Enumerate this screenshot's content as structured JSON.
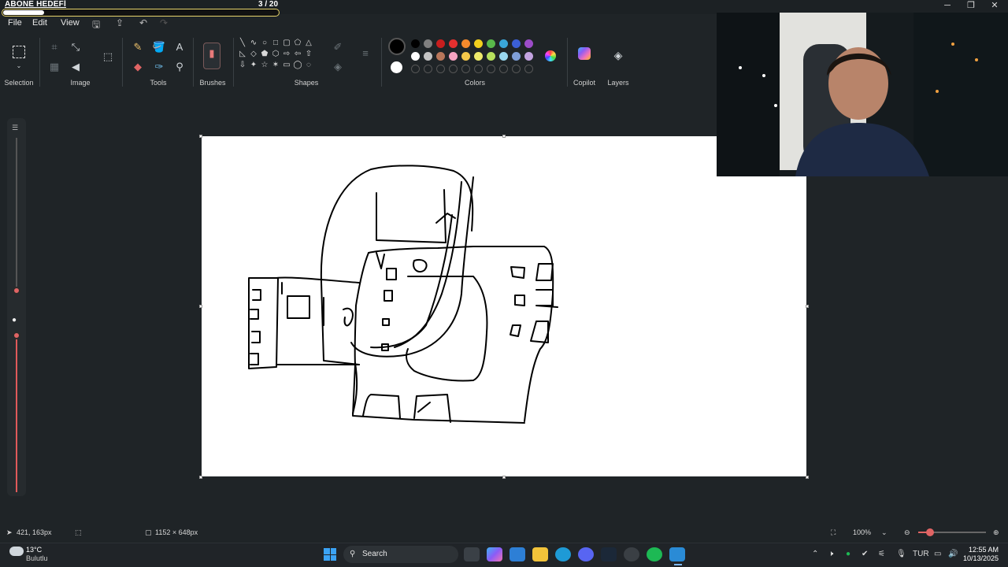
{
  "overlay": {
    "goal_label": "ABONE HEDEFİ",
    "goal_count": "3 / 20",
    "goal_progress": 0.15
  },
  "window": {
    "min": "─",
    "max": "❐",
    "close": "✕"
  },
  "menu": {
    "file": "File",
    "edit": "Edit",
    "view": "View"
  },
  "ribbon": {
    "groups": {
      "selection": "Selection",
      "image": "Image",
      "tools": "Tools",
      "brushes": "Brushes",
      "shapes": "Shapes",
      "colors": "Colors",
      "copilot": "Copilot",
      "layers": "Layers"
    },
    "palette_row1": [
      "#000000",
      "#7f7f7f",
      "#c81e1e",
      "#e5302f",
      "#f58a2c",
      "#f2cf1d",
      "#59b84a",
      "#3aa6d8",
      "#3b5fd6",
      "#9c4cc8"
    ],
    "palette_row2": [
      "#ffffff",
      "#c3c3c3",
      "#b8765a",
      "#f5a3c0",
      "#f5c84a",
      "#eeea6b",
      "#b6e05c",
      "#9ad8ef",
      "#7f9fd8",
      "#c3a3e0"
    ],
    "primary_color": "#000000",
    "secondary_color": "#ffffff"
  },
  "status": {
    "cursor_pos": "421, 163px",
    "canvas_size": "1152 × 648px",
    "zoom": "100%"
  },
  "taskbar": {
    "weather_temp": "13°C",
    "weather_desc": "Bulutlu",
    "search": "Search",
    "lang": "TUR",
    "time": "12:55 AM",
    "date": "10/13/2025"
  }
}
